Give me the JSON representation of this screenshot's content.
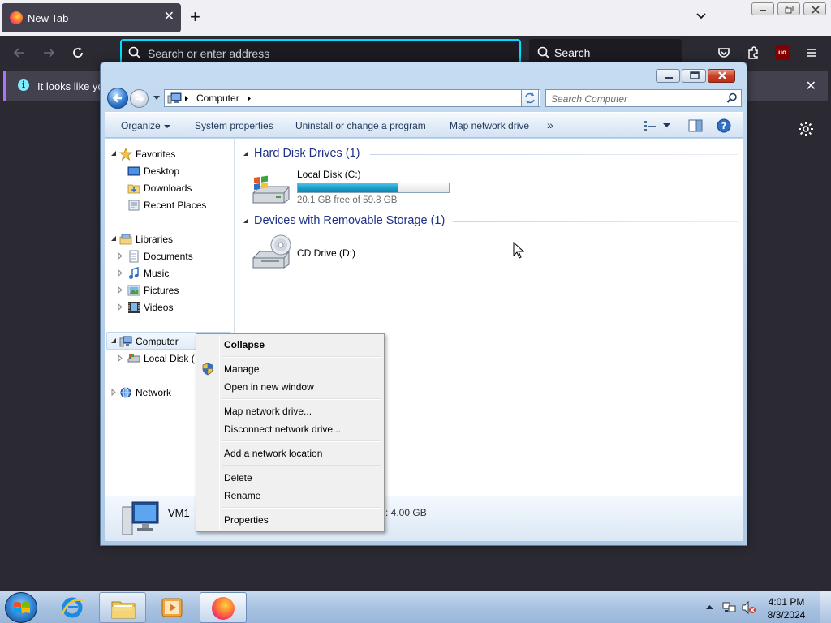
{
  "firefox": {
    "tab": {
      "title": "New Tab"
    },
    "address_placeholder": "Search or enter address",
    "search_label": "Search",
    "notification_text": "It looks like you"
  },
  "explorer": {
    "breadcrumb": [
      "Computer"
    ],
    "search_placeholder": "Search Computer",
    "commands": {
      "organize": "Organize",
      "system_properties": "System properties",
      "uninstall": "Uninstall or change a program",
      "map_drive": "Map network drive",
      "more": "»"
    },
    "nav": {
      "favorites": "Favorites",
      "desktop": "Desktop",
      "downloads": "Downloads",
      "recent_places": "Recent Places",
      "libraries": "Libraries",
      "documents": "Documents",
      "music": "Music",
      "pictures": "Pictures",
      "videos": "Videos",
      "computer": "Computer",
      "local_disk": "Local Disk (",
      "network": "Network"
    },
    "groups": {
      "hdd": "Hard Disk Drives (1)",
      "removable": "Devices with Removable Storage (1)"
    },
    "drives": {
      "c_label": "Local Disk (C:)",
      "c_free": "20.1 GB free of 59.8 GB",
      "c_used_fraction": 0.664,
      "d_label": "CD Drive (D:)"
    },
    "details": {
      "name": "VM1",
      "memory": "y: 4.00 GB"
    }
  },
  "context_menu": {
    "collapse": "Collapse",
    "manage": "Manage",
    "open_new_window": "Open in new window",
    "map_network_drive": "Map network drive...",
    "disconnect_network_drive": "Disconnect network drive...",
    "add_network_location": "Add a network location",
    "delete": "Delete",
    "rename": "Rename",
    "properties": "Properties"
  },
  "taskbar": {
    "time": "4:01 PM",
    "date": "8/3/2024"
  },
  "colors": {
    "firefox_dark": "#2b2a33",
    "url_focus": "#00ddff",
    "progress_fill": "#1d9ec9",
    "group_header": "#1e3287"
  }
}
